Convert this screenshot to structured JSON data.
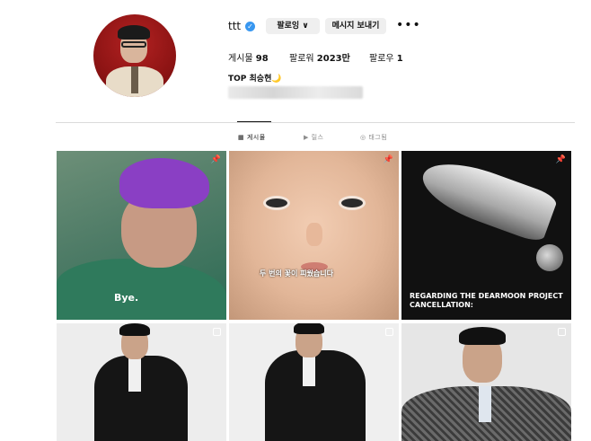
{
  "profile": {
    "username": "ttt",
    "verified_icon": "verified-badge-icon",
    "follow_button": "팔로잉 ∨",
    "message_button": "메시지 보내기",
    "more_icon": "•••",
    "stats": {
      "posts_label": "게시물",
      "posts_value": "98",
      "followers_label": "팔로워",
      "followers_value": "2023만",
      "following_label": "팔로우",
      "following_value": "1"
    },
    "bio_name": "TOP 최승현🌙"
  },
  "tabs": [
    {
      "label": "▦ 게시물",
      "active": true
    },
    {
      "label": "▶ 릴스",
      "active": false
    },
    {
      "label": "◎ 태그됨",
      "active": false
    }
  ],
  "posts": [
    {
      "caption": "Bye.",
      "badge": "pin-icon"
    },
    {
      "caption": "두 번의 꽃이 피웠습니다",
      "badge": "pin-icon"
    },
    {
      "caption": "REGARDING THE DEARMOON PROJECT CANCELLATION:",
      "badge": "pin-icon"
    },
    {
      "caption": "",
      "badge": "multi-photo-icon"
    },
    {
      "caption": "",
      "badge": "multi-photo-icon"
    },
    {
      "caption": "",
      "badge": "multi-photo-icon"
    }
  ],
  "colors": {
    "verified": "#3897f0",
    "button_bg": "#efefef",
    "divider": "#dbdbdb"
  }
}
